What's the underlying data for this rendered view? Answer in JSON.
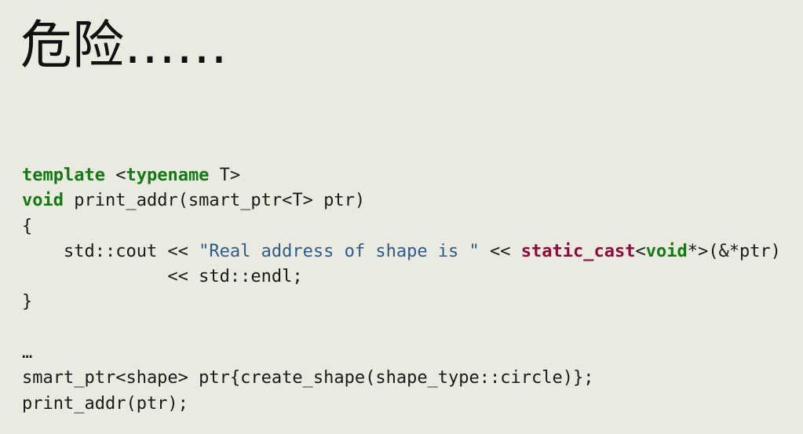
{
  "slide": {
    "title": "危险……",
    "code": {
      "line1": {
        "kw1": "template",
        "t1": " <",
        "kw2": "typename",
        "t2": " T>"
      },
      "line2": {
        "kw1": "void",
        "t1": " print_addr(smart_ptr<T> ptr)"
      },
      "line3": {
        "t1": "{"
      },
      "line4": {
        "t1": "    std::cout << ",
        "str": "\"Real address of shape is \"",
        "t2": " << ",
        "cast": "static_cast",
        "t3": "<",
        "kw": "void",
        "t4": "*>(&*ptr)"
      },
      "line5": {
        "t1": "              << std::endl;"
      },
      "line6": {
        "t1": "}"
      },
      "line7": {
        "t1": ""
      },
      "line8": {
        "t1": "…"
      },
      "line9": {
        "t1": "smart_ptr<shape> ptr{create_shape(shape_type::circle)};"
      },
      "line10": {
        "t1": "print_addr(ptr);"
      }
    }
  },
  "colors": {
    "background": "#ebeae0",
    "keyword": "#137a13",
    "string": "#2f5b8a",
    "cast_keyword": "#8a0a3e",
    "text": "#1a1a1a"
  }
}
